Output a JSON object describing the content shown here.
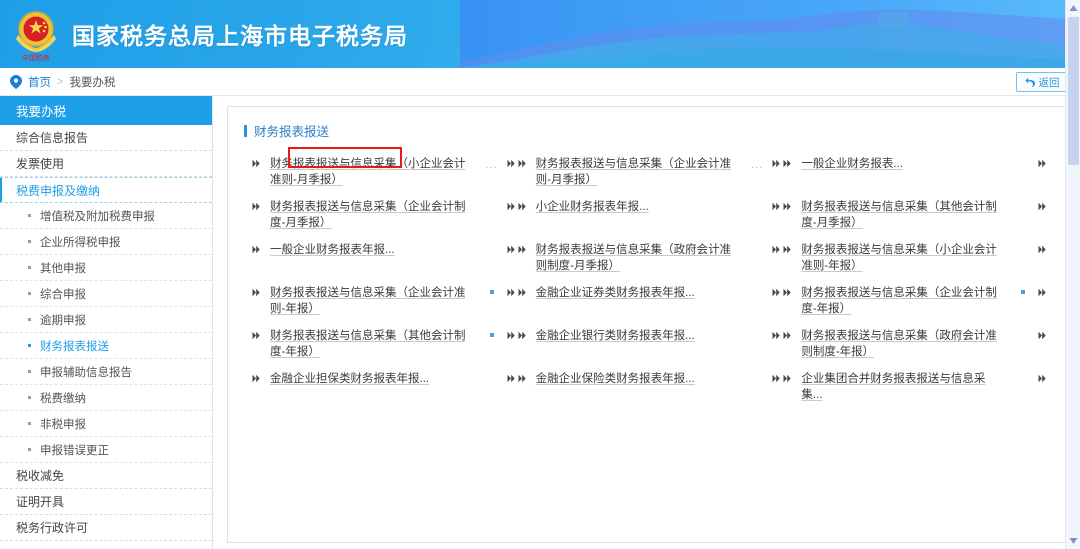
{
  "header": {
    "title": "国家税务总局上海市电子税务局",
    "emblem_icon": "china-tax-emblem-icon",
    "emblem_caption": "中国税务",
    "banner_icon": "great-wall-banner-icon"
  },
  "breadcrumb": {
    "pin_icon": "location-pin-icon",
    "home": "首页",
    "separator": ">",
    "current": "我要办税"
  },
  "return_button": {
    "icon": "undo-arrow-icon",
    "label": "返回"
  },
  "sidebar": {
    "header": "我要办税",
    "items": [
      {
        "label": "综合信息报告",
        "state": "normal"
      },
      {
        "label": "发票使用",
        "state": "normal"
      },
      {
        "label": "税费申报及缴纳",
        "state": "active"
      },
      {
        "label": "增值税及附加税费申报",
        "state": "sub"
      },
      {
        "label": "企业所得税申报",
        "state": "sub"
      },
      {
        "label": "其他申报",
        "state": "sub"
      },
      {
        "label": "综合申报",
        "state": "sub"
      },
      {
        "label": "逾期申报",
        "state": "sub"
      },
      {
        "label": "财务报表报送",
        "state": "sub-selected"
      },
      {
        "label": "申报辅助信息报告",
        "state": "sub"
      },
      {
        "label": "税费缴纳",
        "state": "sub"
      },
      {
        "label": "非税申报",
        "state": "sub"
      },
      {
        "label": "申报错误更正",
        "state": "sub"
      },
      {
        "label": "税收减免",
        "state": "normal"
      },
      {
        "label": "证明开具",
        "state": "normal"
      },
      {
        "label": "税务行政许可",
        "state": "normal"
      }
    ]
  },
  "main": {
    "section_title": "财务报表报送",
    "section_title_bar_color": "#2196e3",
    "highlight_box_color": "#e8191b",
    "items": [
      {
        "label": "财务报表报送与信息采集（小企业会计准则-月季报）",
        "icon": "arrow-bullet-icon",
        "truncated": true,
        "highlighted": true
      },
      {
        "label": "财务报表报送与信息采集（企业会计准则-月季报）",
        "icon": "arrow-bullet-icon",
        "truncated": true,
        "highlighted": false
      },
      {
        "label": "一般企业财务报表...",
        "icon": "arrow-bullet-icon",
        "truncated": false,
        "highlighted": false
      },
      {
        "label": "财务报表报送与信息采集（企业会计制度-月季报）",
        "icon": "arrow-bullet-icon",
        "truncated": false,
        "highlighted": false
      },
      {
        "label": "小企业财务报表年报...",
        "icon": "arrow-bullet-icon",
        "truncated": false,
        "highlighted": false
      },
      {
        "label": "财务报表报送与信息采集（其他会计制度-月季报）",
        "icon": "arrow-bullet-icon",
        "truncated": false,
        "highlighted": false
      },
      {
        "label": "一般企业财务报表年报...",
        "icon": "arrow-bullet-icon",
        "truncated": false,
        "highlighted": false
      },
      {
        "label": "财务报表报送与信息采集（政府会计准则制度-月季报）",
        "icon": "arrow-bullet-icon",
        "truncated": false,
        "highlighted": false
      },
      {
        "label": "财务报表报送与信息采集（小企业会计准则-年报）",
        "icon": "arrow-bullet-icon",
        "truncated": false,
        "highlighted": false
      },
      {
        "label": "财务报表报送与信息采集（企业会计准则-年报）",
        "icon": "arrow-bullet-icon",
        "truncated": false,
        "highlighted": false,
        "dot": true
      },
      {
        "label": "金融企业证券类财务报表年报...",
        "icon": "arrow-bullet-icon",
        "truncated": false,
        "highlighted": false
      },
      {
        "label": "财务报表报送与信息采集（企业会计制度-年报）",
        "icon": "arrow-bullet-icon",
        "truncated": false,
        "highlighted": false,
        "dot": true
      },
      {
        "label": "财务报表报送与信息采集（其他会计制度-年报）",
        "icon": "arrow-bullet-icon",
        "truncated": false,
        "highlighted": false,
        "dot": true
      },
      {
        "label": "金融企业银行类财务报表年报...",
        "icon": "arrow-bullet-icon",
        "truncated": false,
        "highlighted": false
      },
      {
        "label": "财务报表报送与信息采集（政府会计准则制度-年报）",
        "icon": "arrow-bullet-icon",
        "truncated": false,
        "highlighted": false
      },
      {
        "label": "金融企业担保类财务报表年报...",
        "icon": "arrow-bullet-icon",
        "truncated": false,
        "highlighted": false
      },
      {
        "label": "金融企业保险类财务报表年报...",
        "icon": "arrow-bullet-icon",
        "truncated": false,
        "highlighted": false
      },
      {
        "label": "企业集团合并财务报表报送与信息采集...",
        "icon": "arrow-bullet-icon",
        "truncated": false,
        "highlighted": false
      }
    ]
  },
  "scrollbar": {
    "up_icon": "scroll-up-arrow-icon",
    "down_icon": "scroll-down-arrow-icon",
    "thumb_icon": "scroll-thumb"
  }
}
